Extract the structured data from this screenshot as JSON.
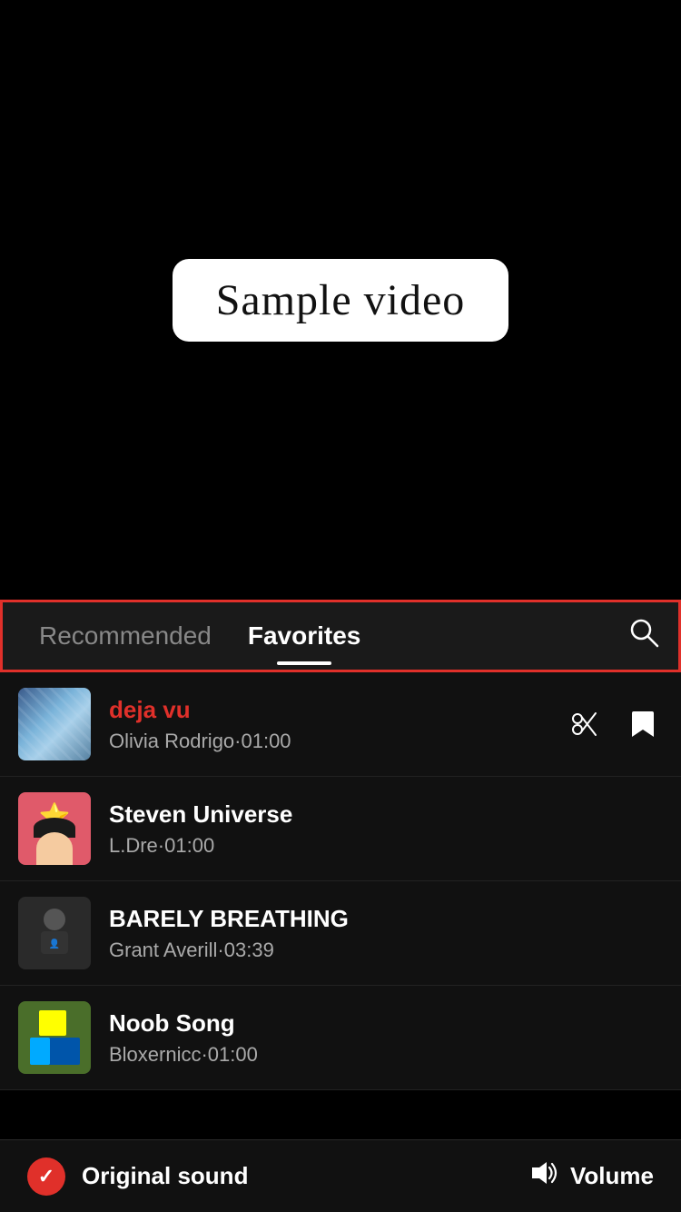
{
  "video": {
    "label": "Sample video"
  },
  "tabs": {
    "recommended_label": "Recommended",
    "favorites_label": "Favorites",
    "active_tab": "favorites"
  },
  "music_list": [
    {
      "id": "deja-vu",
      "title": "deja vu",
      "artist": "Olivia Rodrigo",
      "duration": "01:00",
      "active": true,
      "thumb_type": "deja-vu"
    },
    {
      "id": "steven-universe",
      "title": "Steven Universe",
      "artist": "L.Dre",
      "duration": "01:00",
      "active": false,
      "thumb_type": "steven"
    },
    {
      "id": "barely-breathing",
      "title": "BARELY BREATHING",
      "artist": "Grant Averill",
      "duration": "03:39",
      "active": false,
      "thumb_type": "barely"
    },
    {
      "id": "noob-song",
      "title": "Noob Song",
      "artist": "Bloxernicc",
      "duration": "01:00",
      "active": false,
      "thumb_type": "noob"
    }
  ],
  "bottom_bar": {
    "original_sound_label": "Original sound",
    "volume_label": "Volume"
  },
  "actions": {
    "scissors_label": "scissors",
    "bookmark_label": "bookmark"
  }
}
